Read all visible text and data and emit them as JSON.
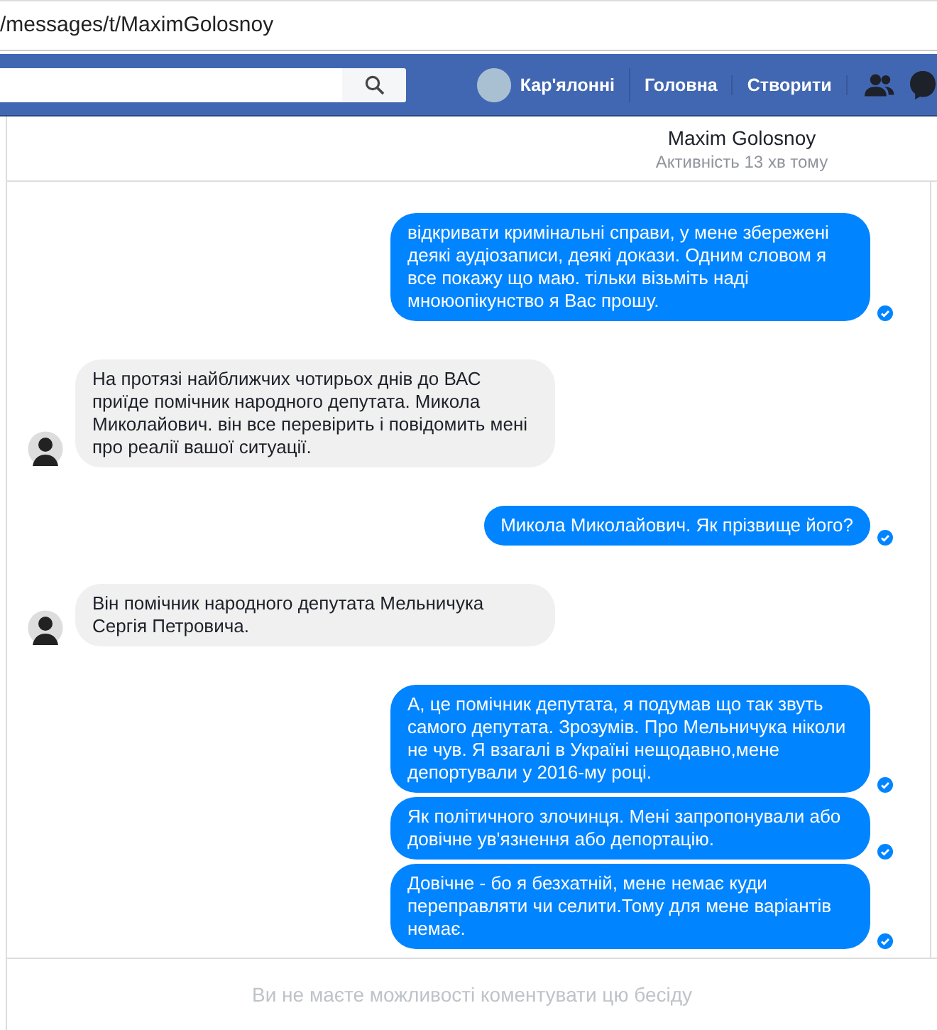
{
  "address_bar": {
    "url": "/messages/t/MaximGolosnoy"
  },
  "top_bar": {
    "profile": {
      "name": "Кар'ялонні"
    },
    "nav": [
      "Головна",
      "Створити"
    ]
  },
  "chat_header": {
    "name": "Maxim Golosnoy",
    "status": "Активність 13 хв тому"
  },
  "messages": [
    {
      "kind": "outgoing",
      "text": "відкривати кримінальні справи, у мене збережені деякі аудіозаписи, деякі докази. Одним словом я все покажу що маю. тільки візьміть наді мноюопікунство я Вас прошу.",
      "seen": true
    },
    {
      "kind": "incoming",
      "text": "На протязі найближчих чотирьох днів до ВАС приїде помічник народного депутата. Микола Миколайович. він все перевірить і повідомить мені про реалії вашої ситуації."
    },
    {
      "kind": "outgoing",
      "text": "Микола Миколайович. Як прізвище його?",
      "seen": true
    },
    {
      "kind": "incoming",
      "text": "Він помічник народного депутата Мельничука Сергія Петровича."
    },
    {
      "kind": "outgoing",
      "text": "А, це помічник депутата, я подумав що так звуть самого депутата. Зрозумів. Про Мельничука ніколи не чув. Я взагалі в Україні нещодавно,мене депортували у 2016-му році.",
      "seen": true
    },
    {
      "kind": "outgoing",
      "text": "Як політичного злочинця. Мені запропонували або довічне ув'язнення або депортацію.",
      "seen": true
    },
    {
      "kind": "outgoing",
      "text": "Довічне - бо я безхатній, мене немає куди переправляти чи селити.Тому для мене варіантів немає.",
      "seen": true
    }
  ],
  "footer": {
    "notice": "Ви не маєте можливості коментувати цю бесіду"
  }
}
